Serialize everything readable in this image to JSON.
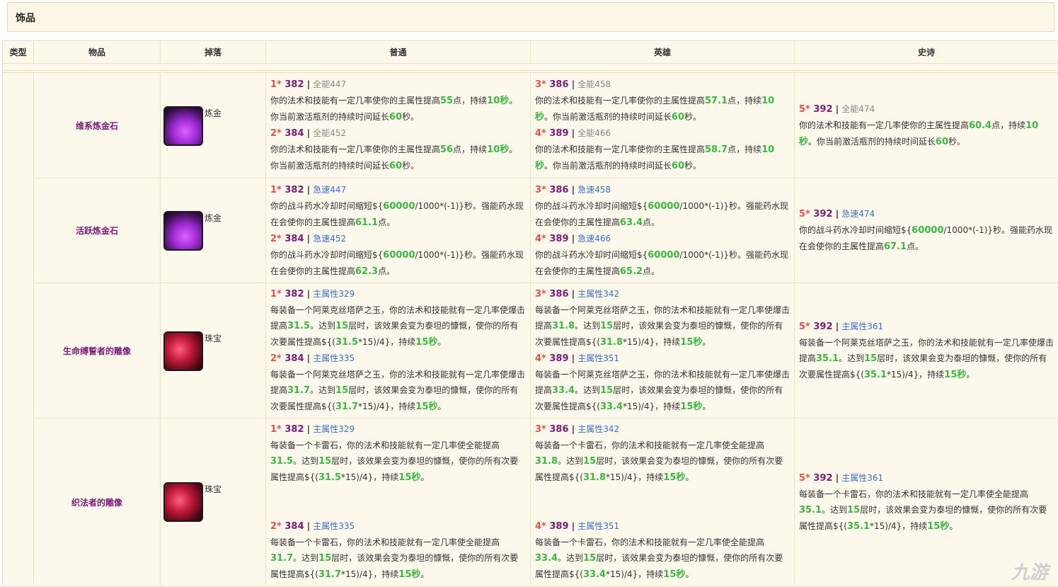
{
  "section_title": "饰品",
  "headers": {
    "type": "类型",
    "item": "物品",
    "drop": "掉落",
    "normal": "普通",
    "heroic": "英雄",
    "epic": "史诗"
  },
  "watermark": "九游",
  "items": [
    {
      "name": "维系炼金石",
      "icon": "flask-icon",
      "drop": "炼金",
      "normal": [
        {
          "star": "1*",
          "ilvl": "382",
          "stat": "全能447",
          "desc": [
            "你的法术和技能有一定几率使你的主属性提高",
            "55",
            "点，持续",
            "10秒",
            "。你当前激活瓶剂的持续时间延长",
            "60",
            "秒。"
          ]
        },
        {
          "star": "2*",
          "ilvl": "384",
          "stat": "全能452",
          "desc": [
            "你的法术和技能有一定几率使你的主属性提高",
            "56",
            "点，持续",
            "10秒",
            "。你当前激活瓶剂的持续时间延长",
            "60",
            "秒。"
          ]
        }
      ],
      "heroic": [
        {
          "star": "3*",
          "ilvl": "386",
          "stat": "全能458",
          "desc": [
            "你的法术和技能有一定几率使你的主属性提高",
            "57.1",
            "点，持续",
            "10秒",
            "。你当前激活瓶剂的持续时间延长",
            "60",
            "秒。"
          ]
        },
        {
          "star": "4*",
          "ilvl": "389",
          "stat": "全能466",
          "desc": [
            "你的法术和技能有一定几率使你的主属性提高",
            "58.7",
            "点，持续",
            "10秒",
            "。你当前激活瓶剂的持续时间延长",
            "60",
            "秒。"
          ]
        }
      ],
      "epic": {
        "star": "5*",
        "ilvl": "392",
        "stat": "全能474",
        "desc": [
          "你的法术和技能有一定几率使你的主属性提高",
          "60.4",
          "点，持续",
          "10秒",
          "。你当前激活瓶剂的持续时间延长",
          "60",
          "秒。"
        ]
      }
    },
    {
      "name": "活跃炼金石",
      "icon": "flask-icon",
      "drop": "炼金",
      "normal": [
        {
          "star": "1*",
          "ilvl": "382",
          "stat": "急速447",
          "desc": [
            "你的战斗药水冷却时间缩短${",
            "60000",
            "/1000*(-1)}秒。强能药水现在会使你的主属性提高",
            "61.1",
            "点。"
          ]
        },
        {
          "star": "2*",
          "ilvl": "384",
          "stat": "急速452",
          "desc": [
            "你的战斗药水冷却时间缩短${",
            "60000",
            "/1000*(-1)}秒。强能药水现在会使你的主属性提高",
            "62.3",
            "点。"
          ]
        }
      ],
      "heroic": [
        {
          "star": "3*",
          "ilvl": "386",
          "stat": "急速458",
          "desc": [
            "你的战斗药水冷却时间缩短${",
            "60000",
            "/1000*(-1)}秒。强能药水现在会使你的主属性提高",
            "63.4",
            "点。"
          ]
        },
        {
          "star": "4*",
          "ilvl": "389",
          "stat": "急速466",
          "desc": [
            "你的战斗药水冷却时间缩短${",
            "60000",
            "/1000*(-1)}秒。强能药水现在会使你的主属性提高",
            "65.2",
            "点。"
          ]
        }
      ],
      "epic": {
        "star": "5*",
        "ilvl": "392",
        "stat": "急速474",
        "desc": [
          "你的战斗药水冷却时间缩短${",
          "60000",
          "/1000*(-1)}秒。强能药水现在会使你的主属性提高",
          "67.1",
          "点。"
        ]
      }
    },
    {
      "name": "生命缚誓者的雕像",
      "icon": "gem-icon",
      "drop": "珠宝",
      "normal": [
        {
          "star": "1*",
          "ilvl": "382",
          "stat": "主属性329",
          "desc": [
            "每装备一个阿莱克丝塔萨之玉，你的法术和技能就有一定几率使爆击提高",
            "31.5",
            "。达到",
            "15",
            "层时，该效果会变为泰坦的慷慨，使你的所有次要属性提高${(",
            "31.5",
            "*15)/4}，持续",
            "15秒",
            "。"
          ]
        },
        {
          "star": "2*",
          "ilvl": "384",
          "stat": "主属性335",
          "desc": [
            "每装备一个阿莱克丝塔萨之玉，你的法术和技能就有一定几率使爆击提高",
            "31.7",
            "。达到",
            "15",
            "层时，该效果会变为泰坦的慷慨，使你的所有次要属性提高${(",
            "31.7",
            "*15)/4}，持续",
            "15秒",
            "。"
          ]
        }
      ],
      "heroic": [
        {
          "star": "3*",
          "ilvl": "386",
          "stat": "主属性342",
          "desc": [
            "每装备一个阿莱克丝塔萨之玉，你的法术和技能就有一定几率使爆击提高",
            "31.8",
            "。达到",
            "15",
            "层时，该效果会变为泰坦的慷慨，使你的所有次要属性提高${(",
            "31.8",
            "*15)/4}，持续",
            "15秒",
            "。"
          ]
        },
        {
          "star": "4*",
          "ilvl": "389",
          "stat": "主属性351",
          "desc": [
            "每装备一个阿莱克丝塔萨之玉，你的法术和技能就有一定几率使爆击提高",
            "33.4",
            "。达到",
            "15",
            "层时，该效果会变为泰坦的慷慨，使你的所有次要属性提高${(",
            "33.4",
            "*15)/4}，持续",
            "15秒",
            "。"
          ]
        }
      ],
      "epic": {
        "star": "5*",
        "ilvl": "392",
        "stat": "主属性361",
        "desc": [
          "每装备一个阿莱克丝塔萨之玉，你的法术和技能就有一定几率使爆击提高",
          "35.1",
          "。达到",
          "15",
          "层时，该效果会变为泰坦的慷慨，使你的所有次要属性提高${(",
          "35.1",
          "*15)/4}，持续",
          "15秒",
          "。"
        ]
      }
    },
    {
      "name": "织法者的雕像",
      "icon": "gem-icon",
      "drop": "珠宝",
      "normal": [
        {
          "star": "1*",
          "ilvl": "382",
          "stat": "主属性329",
          "desc": [
            "每装备一个卡雷石，你的法术和技能就有一定几率使全能提高",
            "31.5",
            "。达到",
            "15",
            "层时，该效果会变为泰坦的慷慨，使你的所有次要属性提高${(",
            "31.5",
            "*15)/4}，持续",
            "15秒",
            "。"
          ]
        },
        {
          "star": "2*",
          "ilvl": "384",
          "stat": "主属性335",
          "desc": [
            "每装备一个卡雷石，你的法术和技能就有一定几率使全能提高",
            "31.7",
            "。达到",
            "15",
            "层时，该效果会变为泰坦的慷慨，使你的所有次要属性提高${(",
            "31.7",
            "*15)/4}，持续",
            "15秒",
            "。"
          ]
        }
      ],
      "heroic": [
        {
          "star": "3*",
          "ilvl": "386",
          "stat": "主属性342",
          "desc": [
            "每装备一个卡雷石，你的法术和技能就有一定几率使全能提高",
            "31.8",
            "。达到",
            "15",
            "层时，该效果会变为泰坦的慷慨，使你的所有次要属性提高${(",
            "31.8",
            "*15)/4}，持续",
            "15秒",
            "。"
          ]
        },
        {
          "star": "4*",
          "ilvl": "389",
          "stat": "主属性351",
          "desc": [
            "每装备一个卡雷石，你的法术和技能就有一定几率使全能提高",
            "33.4",
            "。达到",
            "15",
            "层时，该效果会变为泰坦的慷慨，使你的所有次要属性提高${(",
            "33.4",
            "*15)/4}，持续",
            "15秒",
            "。"
          ]
        }
      ],
      "epic": {
        "star": "5*",
        "ilvl": "392",
        "stat": "主属性361",
        "desc": [
          "每装备一个卡雷石，你的法术和技能就有一定几率使全能提高",
          "35.1",
          "。达到",
          "15",
          "层时，该效果会变为泰坦的慷慨，使你的所有次要属性提高${(",
          "35.1",
          "*15)/4}，持续",
          "15秒",
          "。"
        ]
      }
    }
  ]
}
